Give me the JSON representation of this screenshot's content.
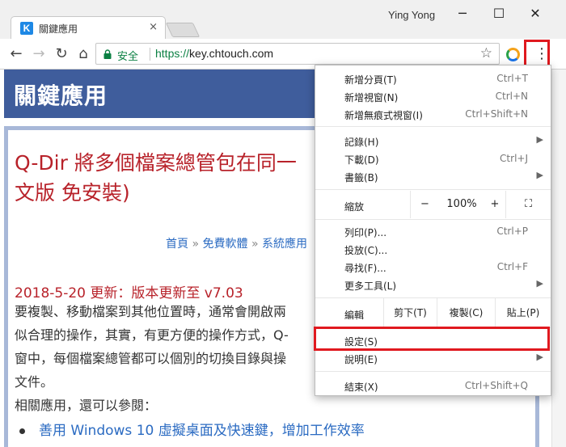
{
  "window": {
    "user": "Ying Yong",
    "minimize": "─",
    "maximize": "☐",
    "close": "✕"
  },
  "tab": {
    "favicon_letter": "K",
    "title": "關鍵應用",
    "close": "×"
  },
  "toolbar": {
    "back": "←",
    "forward": "→",
    "reload": "↻",
    "home": "⌂",
    "secure_label": "安全",
    "url_scheme": "https://",
    "url_host": "key.chtouch.com",
    "star": "☆",
    "menu": "⋮"
  },
  "page": {
    "site_title": "關鍵應用",
    "article_title": "Q-Dir 將多個檔案總管包在同一",
    "article_title_line2": "文版 免安裝)",
    "breadcrumb": [
      "首頁",
      "免費軟體",
      "系統應用"
    ],
    "breadcrumb_sep": "»",
    "update": "2018-5-20 更新：版本更新至 v7.03",
    "lines": [
      "要複製、移動檔案到其他位置時，通常會開啟兩",
      "似合理的操作，其實，有更方便的操作方式，Q-",
      "窗中，每個檔案總管都可以個別的切換目錄與操",
      "文件。",
      "相關應用，還可以參閱："
    ],
    "related_link": "善用 Windows 10 虛擬桌面及快速鍵，增加工作效率"
  },
  "menu": {
    "new_tab": {
      "label": "新增分頁(T)",
      "shortcut": "Ctrl+T"
    },
    "new_window": {
      "label": "新增視窗(N)",
      "shortcut": "Ctrl+N"
    },
    "incognito": {
      "label": "新增無痕式視窗(I)",
      "shortcut": "Ctrl+Shift+N"
    },
    "history": {
      "label": "記錄(H)",
      "submenu": "▶"
    },
    "downloads": {
      "label": "下載(D)",
      "shortcut": "Ctrl+J"
    },
    "bookmarks": {
      "label": "書籤(B)",
      "submenu": "▶"
    },
    "zoom": {
      "label": "縮放",
      "minus": "−",
      "value": "100%",
      "plus": "+",
      "fullscreen": "⛶"
    },
    "print": {
      "label": "列印(P)...",
      "shortcut": "Ctrl+P"
    },
    "cast": {
      "label": "投放(C)..."
    },
    "find": {
      "label": "尋找(F)...",
      "shortcut": "Ctrl+F"
    },
    "more_tools": {
      "label": "更多工具(L)",
      "submenu": "▶"
    },
    "edit": {
      "label": "編輯",
      "cut": "剪下(T)",
      "copy": "複製(C)",
      "paste": "貼上(P)"
    },
    "settings": {
      "label": "設定(S)"
    },
    "help": {
      "label": "說明(E)",
      "submenu": "▶"
    },
    "exit": {
      "label": "結束(X)",
      "shortcut": "Ctrl+Shift+Q"
    }
  }
}
